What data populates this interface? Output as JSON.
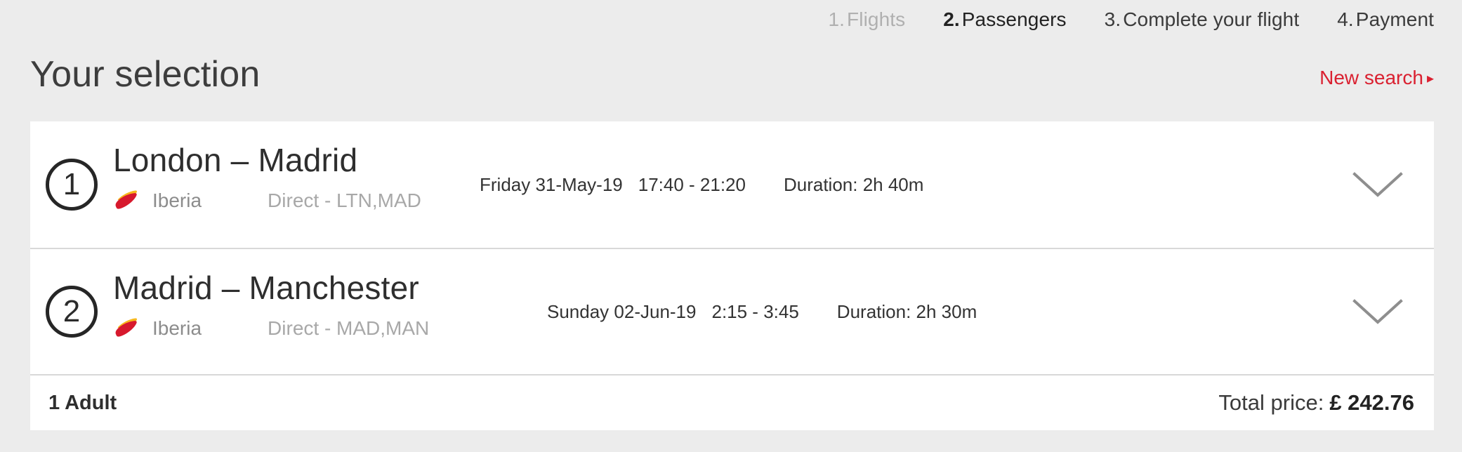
{
  "steps": [
    {
      "num": "1.",
      "label": "Flights",
      "state": "done"
    },
    {
      "num": "2.",
      "label": "Passengers",
      "state": "active"
    },
    {
      "num": "3.",
      "label": "Complete your flight",
      "state": "todo"
    },
    {
      "num": "4.",
      "label": "Payment",
      "state": "todo"
    }
  ],
  "header": {
    "title": "Your selection",
    "new_search_label": "New search",
    "new_search_caret": "▸",
    "accent_color": "#da2131"
  },
  "flights": [
    {
      "index": "1",
      "route": "London – Madrid",
      "airline": "Iberia",
      "airline_logo": "iberia-logo",
      "stops": "Direct - LTN,MAD",
      "date": "Friday 31-May-19",
      "times": "17:40 - 21:20",
      "duration": "Duration: 2h 40m",
      "expand_icon": "chevron-down-icon"
    },
    {
      "index": "2",
      "route": "Madrid – Manchester",
      "airline": "Iberia",
      "airline_logo": "iberia-logo",
      "stops": "Direct - MAD,MAN",
      "date": "Sunday 02-Jun-19",
      "times": "2:15 - 3:45",
      "duration": "Duration: 2h 30m",
      "expand_icon": "chevron-down-icon"
    }
  ],
  "footer": {
    "passengers": "1 Adult",
    "total_label": "Total price:",
    "total_amount": "£ 242.76"
  },
  "colors": {
    "page_background": "#ececec",
    "card_background": "#ffffff",
    "divider": "#d8d8d8",
    "muted_text": "#a8a8a8",
    "accent_red": "#da2131",
    "logo_red": "#d7192d",
    "logo_yellow": "#f7b71d"
  }
}
